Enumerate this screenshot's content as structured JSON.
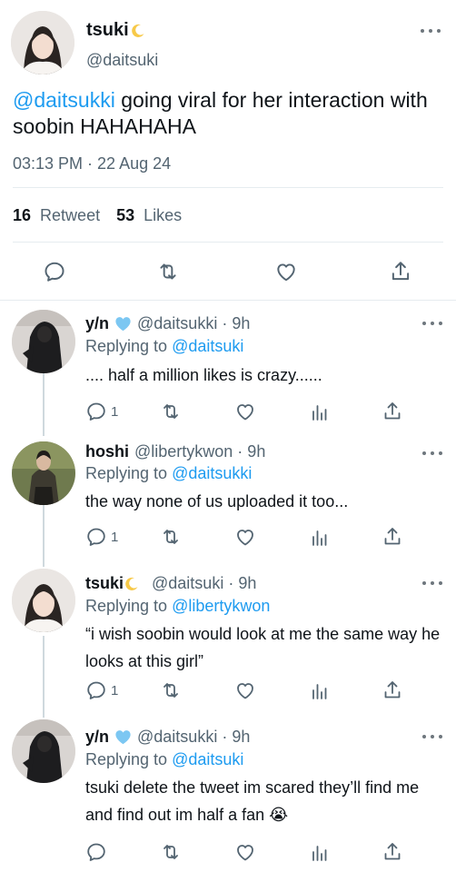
{
  "main_tweet": {
    "author_name": "tsuki",
    "author_handle": "@daitsuki",
    "mention": "@daitsukki",
    "text": " going viral for her interaction with soobin HAHAHAHA",
    "timestamp": "03:13 PM · 22 Aug 24",
    "retweets_count": "16",
    "retweets_label": "Retweet",
    "likes_count": "53",
    "likes_label": "Likes"
  },
  "replies": [
    {
      "name": "y/n",
      "handle_time": "@daitsukki · 9h",
      "replying_prefix": "Replying to ",
      "replying_to": "@daitsuki",
      "text": ".... half a million likes is crazy......",
      "reply_count": "1"
    },
    {
      "name": "hoshi",
      "handle_time": "@libertykwon · 9h",
      "replying_prefix": "Replying to ",
      "replying_to": "@daitsukki",
      "text": "the way none of us uploaded it too...",
      "reply_count": "1"
    },
    {
      "name": "tsuki",
      "handle_time": "@daitsuki · 9h",
      "replying_prefix": "Replying to ",
      "replying_to": "@libertykwon",
      "text": "“i wish soobin would look at me the same way he looks at this girl”",
      "reply_count": "1"
    },
    {
      "name": "y/n",
      "handle_time": "@daitsukki · 9h",
      "replying_prefix": "Replying to ",
      "replying_to": "@daitsuki",
      "text": "tsuki delete the tweet im scared they’ll find me and find out im half a fan 😭",
      "reply_count": ""
    }
  ],
  "icons": {
    "reply": "reply-icon",
    "retweet": "retweet-icon",
    "like": "heart-icon",
    "share": "share-icon",
    "views": "analytics-icon",
    "more": "more-icon",
    "verified": "blue-heart-icon",
    "moon": "moon-icon"
  },
  "colors": {
    "accent": "#1d9bf0",
    "secondary_text": "#536471",
    "verified_heart": "#7cc7f2",
    "moon": "#f7c948"
  }
}
